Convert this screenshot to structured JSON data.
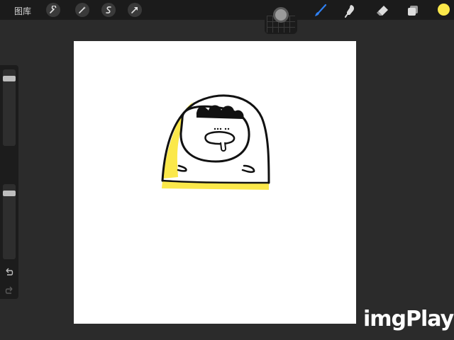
{
  "toolbar": {
    "gallery_label": "图库",
    "left_tools": [
      "wrench-icon",
      "magic-wand-icon",
      "selection-icon",
      "transform-arrow-icon"
    ],
    "right_tools": [
      "brush-icon",
      "smudge-icon",
      "eraser-icon",
      "layers-icon"
    ],
    "active_tool": "brush-icon",
    "current_color": "#fbe84a"
  },
  "sidebar": {
    "brush_size_level": 0.05,
    "opacity_level": 0.05
  },
  "colors": {
    "accent_blue": "#2f7ff0",
    "drawing_yellow": "#fbe84a",
    "drawing_ink": "#111111"
  },
  "watermark": {
    "text": "imgPlay"
  }
}
